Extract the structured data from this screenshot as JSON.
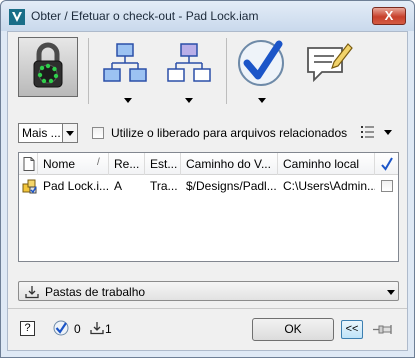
{
  "window": {
    "title": "Obter / Efetuar o check-out - Pad Lock.iam",
    "close_label": "X"
  },
  "toolbar": {
    "buttons": [
      "lock-icon",
      "workflow-tree-icon",
      "workflow-tree-alt-icon",
      "checkmark-circle-icon",
      "comment-edit-icon"
    ]
  },
  "options": {
    "mais_label": "Mais ...",
    "use_released_label": "Utilize o liberado para arquivos relacionados",
    "use_released_checked": false
  },
  "grid": {
    "columns": [
      "Nome",
      "Re...",
      "Est...",
      "Caminho do V...",
      "Caminho local"
    ],
    "rows": [
      {
        "nome": "Pad Lock.i...",
        "re": "A",
        "est": "Tra...",
        "caminho_v": "$/Designs/Padl...",
        "caminho_local": "C:\\Users\\Admin...",
        "checked": false
      }
    ]
  },
  "folders": {
    "label": "Pastas de trabalho"
  },
  "status": {
    "help_label": "?",
    "checked_count": "0",
    "download_count": "1"
  },
  "buttons": {
    "ok_label": "OK",
    "collapse_label": "<<"
  }
}
